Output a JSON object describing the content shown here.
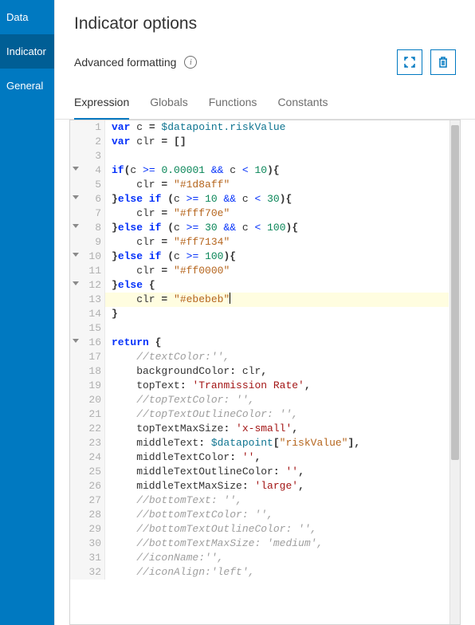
{
  "sidebar": {
    "items": [
      {
        "label": "Data"
      },
      {
        "label": "Indicator"
      },
      {
        "label": "General"
      }
    ],
    "active_index": 1
  },
  "header": {
    "title": "Indicator options",
    "subhead": "Advanced formatting",
    "info_icon_name": "info-icon",
    "expand_icon_name": "expand-icon",
    "delete_icon_name": "trash-icon"
  },
  "tabs": {
    "items": [
      {
        "label": "Expression"
      },
      {
        "label": "Globals"
      },
      {
        "label": "Functions"
      },
      {
        "label": "Constants"
      }
    ],
    "active_index": 0
  },
  "editor": {
    "highlight_line": 13,
    "lines": [
      {
        "n": 1,
        "fold": false,
        "tokens": [
          [
            "kw",
            "var"
          ],
          [
            "id",
            " c "
          ],
          [
            "punc",
            "= "
          ],
          [
            "tealv",
            "$datapoint.riskValue"
          ]
        ]
      },
      {
        "n": 2,
        "fold": false,
        "tokens": [
          [
            "kw",
            "var"
          ],
          [
            "id",
            " clr "
          ],
          [
            "punc",
            "= []"
          ]
        ]
      },
      {
        "n": 3,
        "fold": false,
        "tokens": []
      },
      {
        "n": 4,
        "fold": true,
        "tokens": [
          [
            "kw",
            "if"
          ],
          [
            "punc",
            "("
          ],
          [
            "id",
            "c "
          ],
          [
            "op",
            ">= "
          ],
          [
            "num",
            "0.00001"
          ],
          [
            "op",
            " && "
          ],
          [
            "id",
            "c "
          ],
          [
            "op",
            "< "
          ],
          [
            "num",
            "10"
          ],
          [
            "punc",
            "){"
          ]
        ]
      },
      {
        "n": 5,
        "fold": false,
        "tokens": [
          [
            "id",
            "    clr "
          ],
          [
            "punc",
            "= "
          ],
          [
            "strd",
            "\"#1d8aff\""
          ]
        ]
      },
      {
        "n": 6,
        "fold": true,
        "tokens": [
          [
            "punc",
            "}"
          ],
          [
            "kw",
            "else if "
          ],
          [
            "punc",
            "("
          ],
          [
            "id",
            "c "
          ],
          [
            "op",
            ">= "
          ],
          [
            "num",
            "10"
          ],
          [
            "op",
            " && "
          ],
          [
            "id",
            "c "
          ],
          [
            "op",
            "< "
          ],
          [
            "num",
            "30"
          ],
          [
            "punc",
            "){"
          ]
        ]
      },
      {
        "n": 7,
        "fold": false,
        "tokens": [
          [
            "id",
            "    clr "
          ],
          [
            "punc",
            "= "
          ],
          [
            "strd",
            "\"#fff70e\""
          ]
        ]
      },
      {
        "n": 8,
        "fold": true,
        "tokens": [
          [
            "punc",
            "}"
          ],
          [
            "kw",
            "else if "
          ],
          [
            "punc",
            "("
          ],
          [
            "id",
            "c "
          ],
          [
            "op",
            ">= "
          ],
          [
            "num",
            "30"
          ],
          [
            "op",
            " && "
          ],
          [
            "id",
            "c "
          ],
          [
            "op",
            "< "
          ],
          [
            "num",
            "100"
          ],
          [
            "punc",
            "){"
          ]
        ]
      },
      {
        "n": 9,
        "fold": false,
        "tokens": [
          [
            "id",
            "    clr "
          ],
          [
            "punc",
            "= "
          ],
          [
            "strd",
            "\"#ff7134\""
          ]
        ]
      },
      {
        "n": 10,
        "fold": true,
        "tokens": [
          [
            "punc",
            "}"
          ],
          [
            "kw",
            "else if "
          ],
          [
            "punc",
            "("
          ],
          [
            "id",
            "c "
          ],
          [
            "op",
            ">= "
          ],
          [
            "num",
            "100"
          ],
          [
            "punc",
            "){"
          ]
        ]
      },
      {
        "n": 11,
        "fold": false,
        "tokens": [
          [
            "id",
            "    clr "
          ],
          [
            "punc",
            "= "
          ],
          [
            "strd",
            "\"#ff0000\""
          ]
        ]
      },
      {
        "n": 12,
        "fold": true,
        "tokens": [
          [
            "punc",
            "}"
          ],
          [
            "kw",
            "else "
          ],
          [
            "punc",
            "{"
          ]
        ]
      },
      {
        "n": 13,
        "fold": false,
        "tokens": [
          [
            "id",
            "    clr "
          ],
          [
            "punc",
            "= "
          ],
          [
            "strd",
            "\"#ebebeb\""
          ]
        ]
      },
      {
        "n": 14,
        "fold": false,
        "tokens": [
          [
            "punc",
            "}"
          ]
        ]
      },
      {
        "n": 15,
        "fold": false,
        "tokens": []
      },
      {
        "n": 16,
        "fold": true,
        "tokens": [
          [
            "kw",
            "return"
          ],
          [
            "punc",
            " {"
          ]
        ]
      },
      {
        "n": 17,
        "fold": false,
        "tokens": [
          [
            "id",
            "    "
          ],
          [
            "cmt",
            "//textColor:'',"
          ]
        ]
      },
      {
        "n": 18,
        "fold": false,
        "tokens": [
          [
            "id",
            "    backgroundColor"
          ],
          [
            "punc",
            ": "
          ],
          [
            "id",
            "clr"
          ],
          [
            "punc",
            ","
          ]
        ]
      },
      {
        "n": 19,
        "fold": false,
        "tokens": [
          [
            "id",
            "    topText"
          ],
          [
            "punc",
            ": "
          ],
          [
            "str",
            "'Tranmission Rate'"
          ],
          [
            "punc",
            ","
          ]
        ]
      },
      {
        "n": 20,
        "fold": false,
        "tokens": [
          [
            "id",
            "    "
          ],
          [
            "cmt",
            "//topTextColor: '',"
          ]
        ]
      },
      {
        "n": 21,
        "fold": false,
        "tokens": [
          [
            "id",
            "    "
          ],
          [
            "cmt",
            "//topTextOutlineColor: '',"
          ]
        ]
      },
      {
        "n": 22,
        "fold": false,
        "tokens": [
          [
            "id",
            "    topTextMaxSize"
          ],
          [
            "punc",
            ": "
          ],
          [
            "str",
            "'x-small'"
          ],
          [
            "punc",
            ","
          ]
        ]
      },
      {
        "n": 23,
        "fold": false,
        "tokens": [
          [
            "id",
            "    middleText"
          ],
          [
            "punc",
            ": "
          ],
          [
            "tealv",
            "$datapoint"
          ],
          [
            "punc",
            "["
          ],
          [
            "strd",
            "\"riskValue\""
          ],
          [
            "punc",
            "],"
          ]
        ]
      },
      {
        "n": 24,
        "fold": false,
        "tokens": [
          [
            "id",
            "    middleTextColor"
          ],
          [
            "punc",
            ": "
          ],
          [
            "str",
            "''"
          ],
          [
            "punc",
            ","
          ]
        ]
      },
      {
        "n": 25,
        "fold": false,
        "tokens": [
          [
            "id",
            "    middleTextOutlineColor"
          ],
          [
            "punc",
            ": "
          ],
          [
            "str",
            "''"
          ],
          [
            "punc",
            ","
          ]
        ]
      },
      {
        "n": 26,
        "fold": false,
        "tokens": [
          [
            "id",
            "    middleTextMaxSize"
          ],
          [
            "punc",
            ": "
          ],
          [
            "str",
            "'large'"
          ],
          [
            "punc",
            ","
          ]
        ]
      },
      {
        "n": 27,
        "fold": false,
        "tokens": [
          [
            "id",
            "    "
          ],
          [
            "cmt",
            "//bottomText: '',"
          ]
        ]
      },
      {
        "n": 28,
        "fold": false,
        "tokens": [
          [
            "id",
            "    "
          ],
          [
            "cmt",
            "//bottomTextColor: '',"
          ]
        ]
      },
      {
        "n": 29,
        "fold": false,
        "tokens": [
          [
            "id",
            "    "
          ],
          [
            "cmt",
            "//bottomTextOutlineColor: '',"
          ]
        ]
      },
      {
        "n": 30,
        "fold": false,
        "tokens": [
          [
            "id",
            "    "
          ],
          [
            "cmt",
            "//bottomTextMaxSize: 'medium',"
          ]
        ]
      },
      {
        "n": 31,
        "fold": false,
        "tokens": [
          [
            "id",
            "    "
          ],
          [
            "cmt",
            "//iconName:'',"
          ]
        ]
      },
      {
        "n": 32,
        "fold": false,
        "tokens": [
          [
            "id",
            "    "
          ],
          [
            "cmt",
            "//iconAlign:'left',"
          ]
        ]
      }
    ]
  }
}
